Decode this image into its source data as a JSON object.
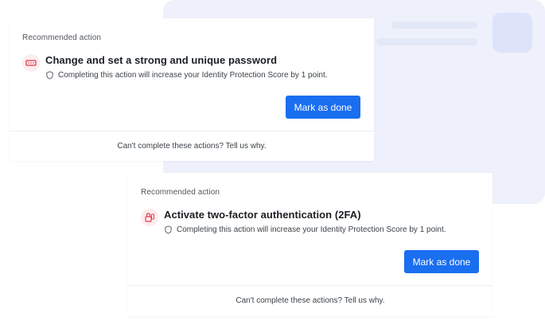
{
  "colors": {
    "primary_button": "#1a6ef0",
    "icon_accent": "#e23b4e",
    "background_panel": "#eef1fb"
  },
  "cards": [
    {
      "label": "Recommended action",
      "icon": "password-icon",
      "title": "Change and set a strong and unique password",
      "description": "Completing this action will increase your Identity Protection Score by 1 point.",
      "button_label": "Mark as done",
      "footer_link": "Can't complete these actions? Tell us why."
    },
    {
      "label": "Recommended action",
      "icon": "two-factor-icon",
      "title": "Activate two-factor authentication (2FA)",
      "description": "Completing this action will increase your Identity Protection Score by 1 point.",
      "button_label": "Mark as done",
      "footer_link": "Can't complete these actions? Tell us why."
    }
  ]
}
